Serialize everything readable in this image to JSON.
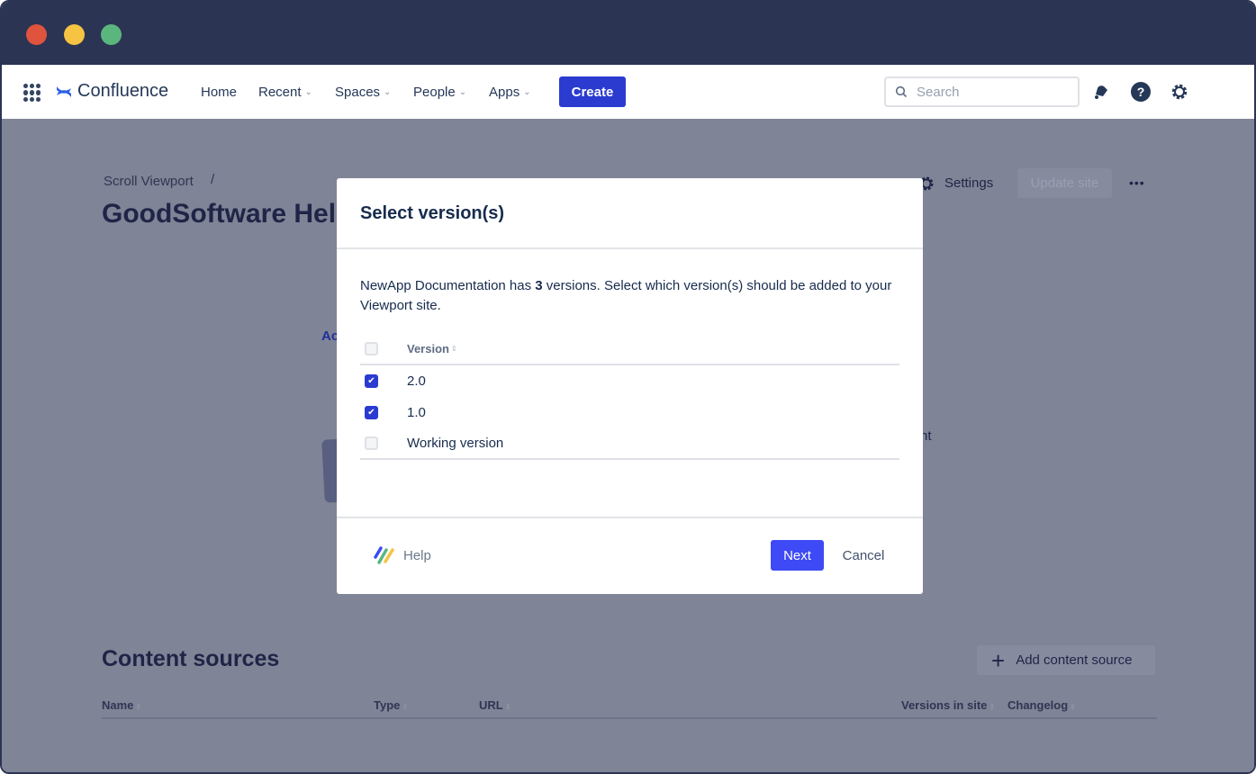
{
  "nav": {
    "brand": "Confluence",
    "items": [
      {
        "label": "Home",
        "dropdown": false
      },
      {
        "label": "Recent",
        "dropdown": true
      },
      {
        "label": "Spaces",
        "dropdown": true
      },
      {
        "label": "People",
        "dropdown": true
      },
      {
        "label": "Apps",
        "dropdown": true
      }
    ],
    "create": "Create",
    "search_placeholder": "Search"
  },
  "page": {
    "breadcrumb": "Scroll Viewport",
    "breadcrumb_sep": "/",
    "title": "GoodSoftware Help",
    "settings": "Settings",
    "update_site": "Update site",
    "more": "•••",
    "partial_link": "Ac",
    "partial_text": "nt",
    "content_sources": {
      "title": "Content sources",
      "add_button": "Add content source",
      "columns": [
        "Name",
        "Type",
        "URL",
        "Versions in site",
        "Changelog"
      ]
    }
  },
  "modal": {
    "title": "Select version(s)",
    "desc_pre": "NewApp Documentation has ",
    "desc_count": "3",
    "desc_post": " versions. Select which version(s) should be added to your Viewport site.",
    "column": "Version",
    "rows": [
      {
        "label": "2.0",
        "checked": true
      },
      {
        "label": "1.0",
        "checked": true
      },
      {
        "label": "Working version",
        "checked": false
      }
    ],
    "help": "Help",
    "next": "Next",
    "cancel": "Cancel"
  },
  "colors": {
    "titlebar": "#2c3454",
    "primary": "#2b3bd0",
    "next": "#3d4af5"
  }
}
